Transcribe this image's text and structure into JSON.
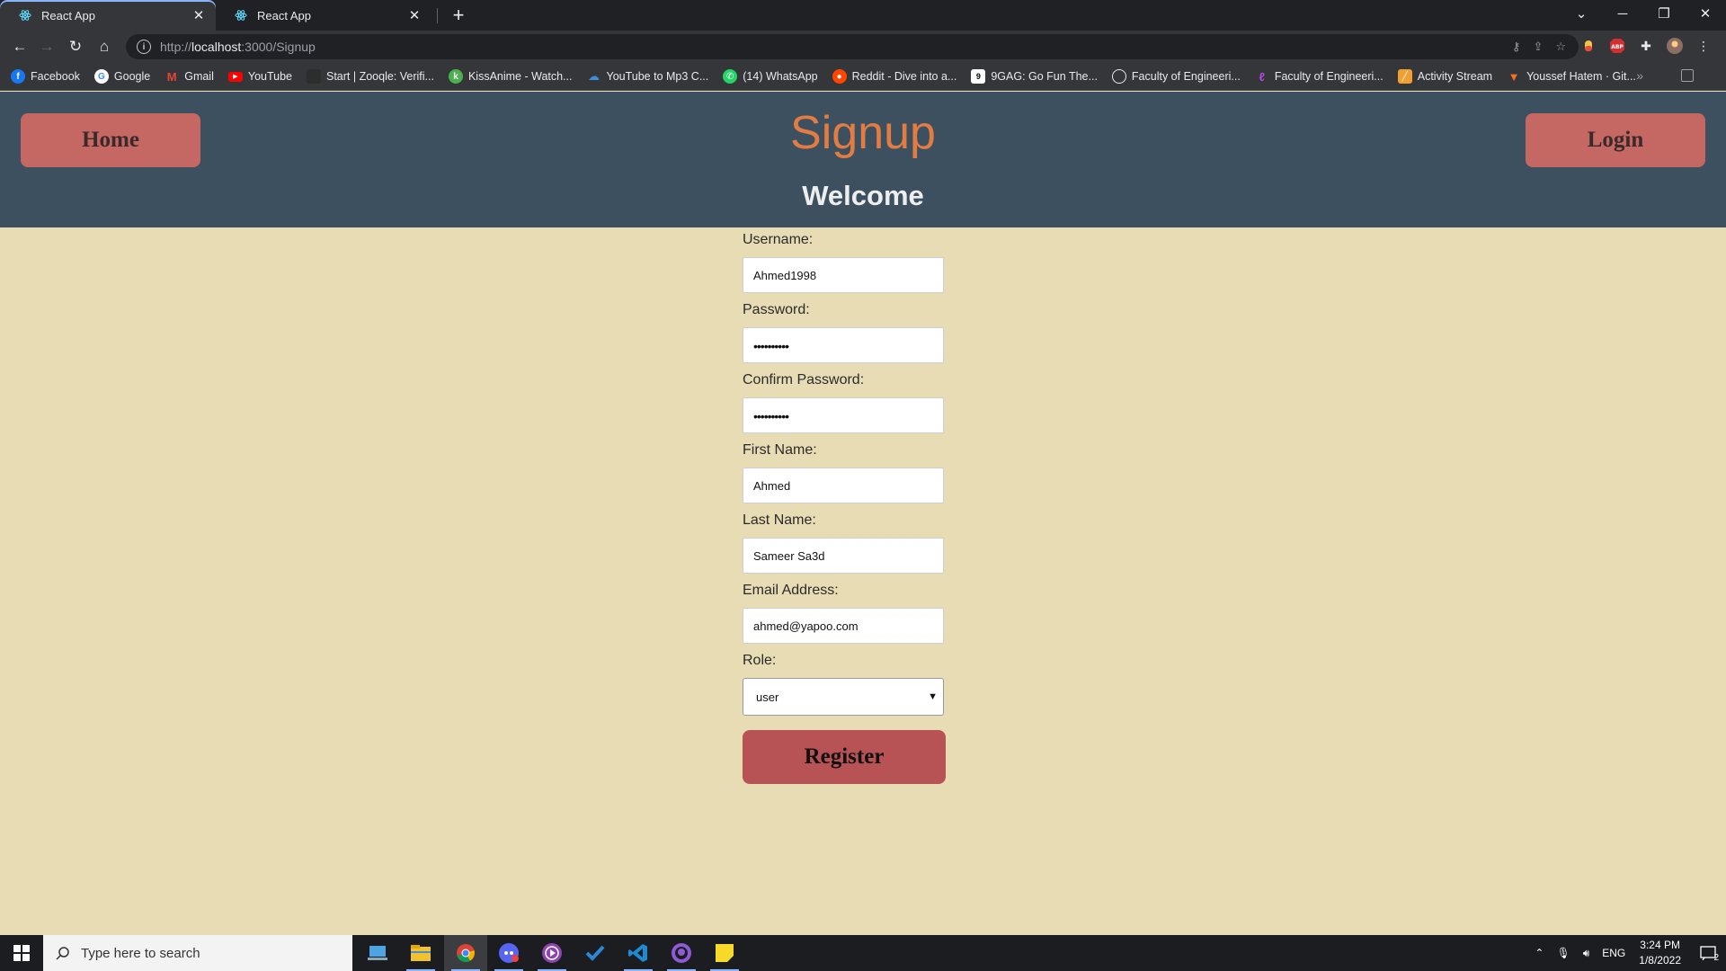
{
  "browser": {
    "tabs": [
      {
        "title": "React App",
        "active": true
      },
      {
        "title": "React App",
        "active": false
      }
    ],
    "url_prefix": "http://",
    "url_host": "localhost",
    "url_rest": ":3000/Signup",
    "bookmarks": [
      {
        "label": "Facebook",
        "icon": "facebook-icon",
        "color": "#1877f2"
      },
      {
        "label": "Google",
        "icon": "google-icon",
        "color": "#ffffff"
      },
      {
        "label": "Gmail",
        "icon": "gmail-icon",
        "color": "#ea4335"
      },
      {
        "label": "YouTube",
        "icon": "youtube-icon",
        "color": "#ff0000"
      },
      {
        "label": "Start | Zooqle: Verifi...",
        "icon": "zooqle-icon",
        "color": "#2d2d2d"
      },
      {
        "label": "KissAnime - Watch...",
        "icon": "kissanime-icon",
        "color": "#4caf50"
      },
      {
        "label": "YouTube to Mp3 C...",
        "icon": "download-cloud-icon",
        "color": "#3a8fd9"
      },
      {
        "label": "(14) WhatsApp",
        "icon": "whatsapp-icon",
        "color": "#25d366"
      },
      {
        "label": "Reddit - Dive into a...",
        "icon": "reddit-icon",
        "color": "#ff4500"
      },
      {
        "label": "9GAG: Go Fun The...",
        "icon": "9gag-icon",
        "color": "#000000"
      },
      {
        "label": "Faculty of Engineeri...",
        "icon": "globe-icon",
        "color": "#5f6368"
      },
      {
        "label": "Faculty of Engineeri...",
        "icon": "feather-icon",
        "color": "#b24bd6"
      },
      {
        "label": "Activity Stream",
        "icon": "activity-stream-icon",
        "color": "#f0a030"
      },
      {
        "label": "Youssef Hatem · Git...",
        "icon": "gitlab-icon",
        "color": "#fc6d26"
      }
    ]
  },
  "app": {
    "home_label": "Home",
    "login_label": "Login",
    "title": "Signup",
    "subtitle": "Welcome",
    "accent_title": "#e27c42",
    "header_bg": "#3d5060",
    "page_bg": "#e8dcb5",
    "button_bg": "#c56763"
  },
  "form": {
    "username_label": "Username:",
    "username_value": "Ahmed1998",
    "password_label": "Password:",
    "password_value": "••••••••••",
    "confirm_label": "Confirm Password:",
    "confirm_value": "••••••••••",
    "first_name_label": "First Name:",
    "first_name_value": "Ahmed",
    "last_name_label": "Last Name:",
    "last_name_value": "Sameer Sa3d",
    "email_label": "Email Address:",
    "email_value": "ahmed@yapoo.com",
    "role_label": "Role:",
    "role_value": "user",
    "register_label": "Register"
  },
  "taskbar": {
    "search_placeholder": "Type here to search",
    "lang": "ENG",
    "time": "3:24 PM",
    "date": "1/8/2022",
    "notif_count": "2"
  }
}
